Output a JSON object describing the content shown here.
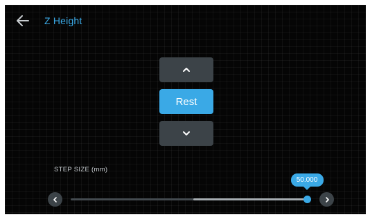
{
  "header": {
    "title": "Z Height",
    "back_icon": "arrow-left-icon"
  },
  "jog": {
    "up_icon": "chevron-up-icon",
    "rest_label": "Rest",
    "down_icon": "chevron-down-icon"
  },
  "step_size": {
    "label": "STEP SIZE (mm)",
    "value_text": "50.000",
    "level_fraction": 1.0,
    "decrease_icon": "chevron-left-icon",
    "increase_icon": "chevron-right-icon"
  },
  "colors": {
    "accent": "#3aa9e6",
    "background": "#050505",
    "button": "#3c4348"
  }
}
